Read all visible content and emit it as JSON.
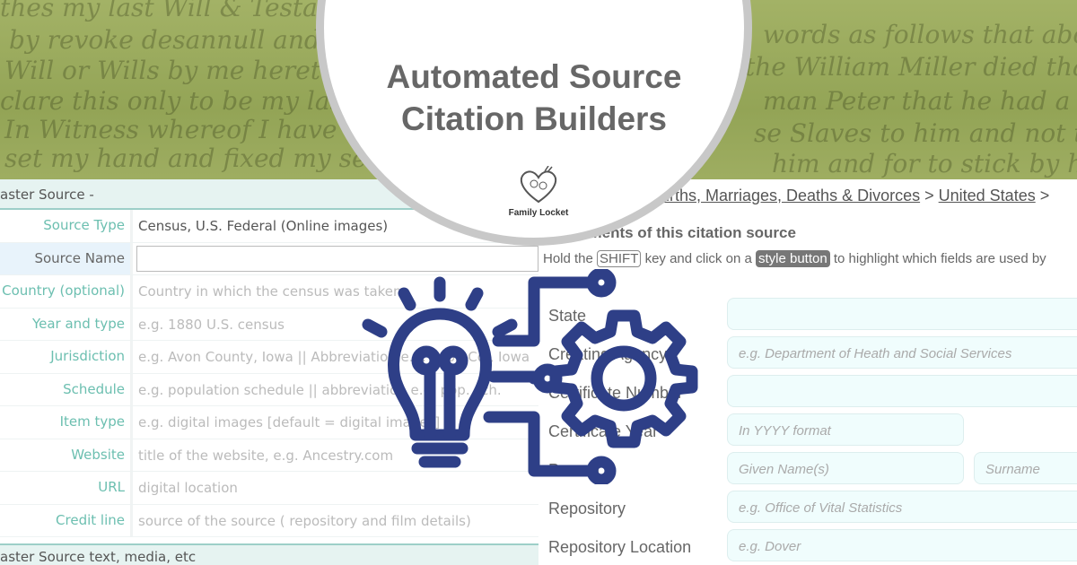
{
  "banner": {
    "title_line1": "Automated Source",
    "title_line2": "Citation Builders",
    "logo_text": "Family Locket"
  },
  "background_script": [
    "thes my last Will & Testament",
    "by revoke desannull and de",
    "Will or Wills by me heretofore",
    "clare this only to be my last",
    "In Witness whereof I have",
    "set my hand and fixed my seal",
    "words as follows that about",
    "the William Miller died that he",
    "man Peter that he had a lwo",
    "se Slaves to him and not to be",
    "him and for to stick by him"
  ],
  "left_form": {
    "header": "aster Source -",
    "rows": [
      {
        "label": "Source Type",
        "value": "Census, U.S. Federal (Online images)",
        "filled": true
      },
      {
        "label": "Source Name",
        "value": "",
        "input": true
      },
      {
        "label": "Country (optional)",
        "value": "Country in which the census was taken"
      },
      {
        "label": "Year and type",
        "value": "e.g. 1880 U.S. census"
      },
      {
        "label": "Jurisdiction",
        "value": "e.g. Avon County, Iowa || Abbreviation e.g. Avon Co., Iowa"
      },
      {
        "label": "Schedule",
        "value": "e.g. population schedule || abbreviation e.g. pop. sch."
      },
      {
        "label": "Item type",
        "value": "e.g. digital images [default = digital images]"
      },
      {
        "label": "Website",
        "value": "title of the website, e.g. Ancestry.com"
      },
      {
        "label": "URL",
        "value": "digital location"
      },
      {
        "label": "Credit line",
        "value": "source of the source ( repository and film details)"
      }
    ],
    "footer": "aster Source text, media, etc"
  },
  "right_form": {
    "breadcrumb": [
      "Births, Marriages, Deaths & Divorces",
      "United States"
    ],
    "breadcrumb_sep": ">",
    "title": "Elements of this citation source",
    "hint": {
      "pre": "Hold the",
      "key": "SHIFT",
      "mid": "key and click on a",
      "button": "style button",
      "post": "to highlight which fields are used by"
    },
    "fields": [
      {
        "label": "State",
        "placeholder": ""
      },
      {
        "label": "Creating Agency",
        "placeholder": "e.g. Department of Heath and Social Services"
      },
      {
        "label": "Certificate Number",
        "placeholder": ""
      },
      {
        "label": "Certificate Year",
        "placeholder": "In YYYY format"
      },
      {
        "label": "Person",
        "placeholder": "Given Name(s)",
        "placeholder2": "Surname"
      },
      {
        "label": "Repository",
        "placeholder": "e.g. Office of Vital Statistics"
      },
      {
        "label": "Repository Location",
        "placeholder": "e.g. Dover"
      }
    ]
  },
  "colors": {
    "icon": "#2e3f87",
    "label_teal": "#6cbfb0",
    "parchment": "#9aaa5c"
  },
  "icons": [
    "lightbulb-icon",
    "gear-icon",
    "circuit-icon",
    "heart-locket-logo"
  ]
}
